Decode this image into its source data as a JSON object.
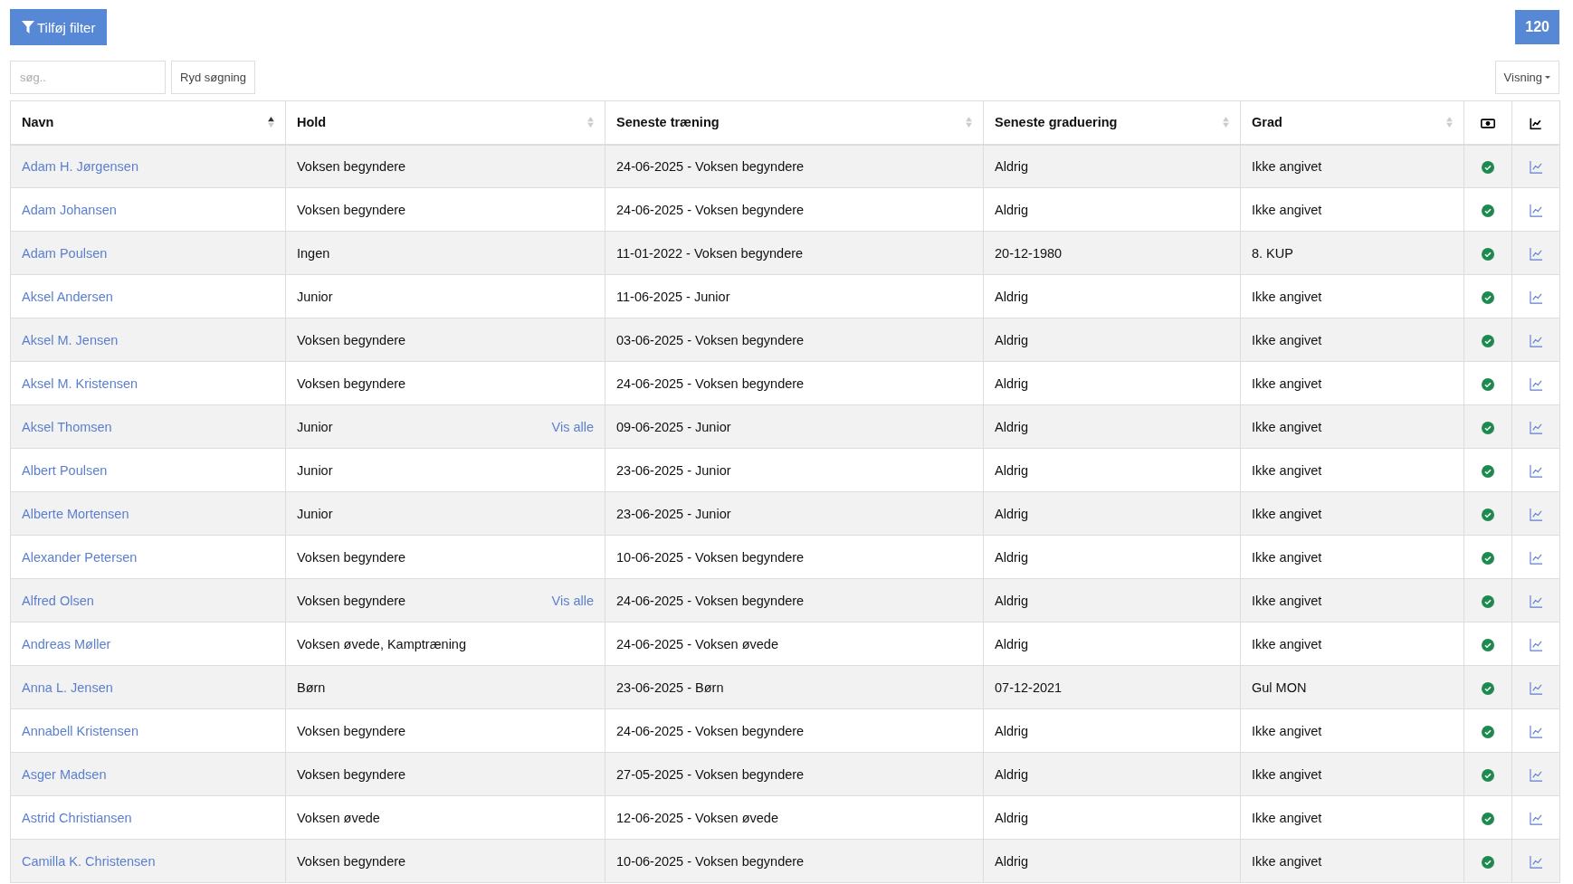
{
  "filter_button": {
    "label": "Tilføj filter"
  },
  "count_badge": "120",
  "search": {
    "placeholder": "søg.."
  },
  "clear_button": "Ryd søgning",
  "view_dropdown": "Visning",
  "table": {
    "columns": [
      {
        "label": "Navn",
        "sorted": true
      },
      {
        "label": "Hold",
        "sorted": false
      },
      {
        "label": "Seneste træning",
        "sorted": false
      },
      {
        "label": "Seneste graduering",
        "sorted": false
      },
      {
        "label": "Grad",
        "sorted": false
      }
    ],
    "rows": [
      {
        "name": "Adam H. Jørgensen",
        "hold": "Voksen begyndere",
        "training": "24-06-2025 - Voksen begyndere",
        "graduation": "Aldrig",
        "grade": "Ikke angivet",
        "paid": true
      },
      {
        "name": "Adam Johansen",
        "hold": "Voksen begyndere",
        "training": "24-06-2025 - Voksen begyndere",
        "graduation": "Aldrig",
        "grade": "Ikke angivet",
        "paid": true
      },
      {
        "name": "Adam Poulsen",
        "hold": "Ingen",
        "training": "11-01-2022 - Voksen begyndere",
        "graduation": "20-12-1980",
        "grade": "8. KUP",
        "paid": true
      },
      {
        "name": "Aksel Andersen",
        "hold": "Junior",
        "training": "11-06-2025 - Junior",
        "graduation": "Aldrig",
        "grade": "Ikke angivet",
        "paid": true
      },
      {
        "name": "Aksel M. Jensen",
        "hold": "Voksen begyndere",
        "training": "03-06-2025 - Voksen begyndere",
        "graduation": "Aldrig",
        "grade": "Ikke angivet",
        "paid": true
      },
      {
        "name": "Aksel M. Kristensen",
        "hold": "Voksen begyndere",
        "training": "24-06-2025 - Voksen begyndere",
        "graduation": "Aldrig",
        "grade": "Ikke angivet",
        "paid": true
      },
      {
        "name": "Aksel Thomsen",
        "hold": "Junior",
        "hold_link": "Vis alle",
        "training": "09-06-2025 - Junior",
        "graduation": "Aldrig",
        "grade": "Ikke angivet",
        "paid": true
      },
      {
        "name": "Albert Poulsen",
        "hold": "Junior",
        "training": "23-06-2025 - Junior",
        "graduation": "Aldrig",
        "grade": "Ikke angivet",
        "paid": true
      },
      {
        "name": "Alberte Mortensen",
        "hold": "Junior",
        "training": "23-06-2025 - Junior",
        "graduation": "Aldrig",
        "grade": "Ikke angivet",
        "paid": true
      },
      {
        "name": "Alexander Petersen",
        "hold": "Voksen begyndere",
        "training": "10-06-2025 - Voksen begyndere",
        "graduation": "Aldrig",
        "grade": "Ikke angivet",
        "paid": true
      },
      {
        "name": "Alfred Olsen",
        "hold": "Voksen begyndere",
        "hold_link": "Vis alle",
        "training": "24-06-2025 - Voksen begyndere",
        "graduation": "Aldrig",
        "grade": "Ikke angivet",
        "paid": true
      },
      {
        "name": "Andreas Møller",
        "hold": "Voksen øvede, Kamptræning",
        "training": "24-06-2025 - Voksen øvede",
        "graduation": "Aldrig",
        "grade": "Ikke angivet",
        "paid": true
      },
      {
        "name": "Anna L. Jensen",
        "hold": "Børn",
        "training": "23-06-2025 - Børn",
        "graduation": "07-12-2021",
        "grade": "Gul MON",
        "paid": true
      },
      {
        "name": "Annabell Kristensen",
        "hold": "Voksen begyndere",
        "training": "24-06-2025 - Voksen begyndere",
        "graduation": "Aldrig",
        "grade": "Ikke angivet",
        "paid": true
      },
      {
        "name": "Asger Madsen",
        "hold": "Voksen begyndere",
        "training": "27-05-2025 - Voksen begyndere",
        "graduation": "Aldrig",
        "grade": "Ikke angivet",
        "paid": true
      },
      {
        "name": "Astrid Christiansen",
        "hold": "Voksen øvede",
        "training": "12-06-2025 - Voksen øvede",
        "graduation": "Aldrig",
        "grade": "Ikke angivet",
        "paid": true
      },
      {
        "name": "Camilla K. Christensen",
        "hold": "Voksen begyndere",
        "training": "10-06-2025 - Voksen begyndere",
        "graduation": "Aldrig",
        "grade": "Ikke angivet",
        "paid": true
      }
    ]
  }
}
